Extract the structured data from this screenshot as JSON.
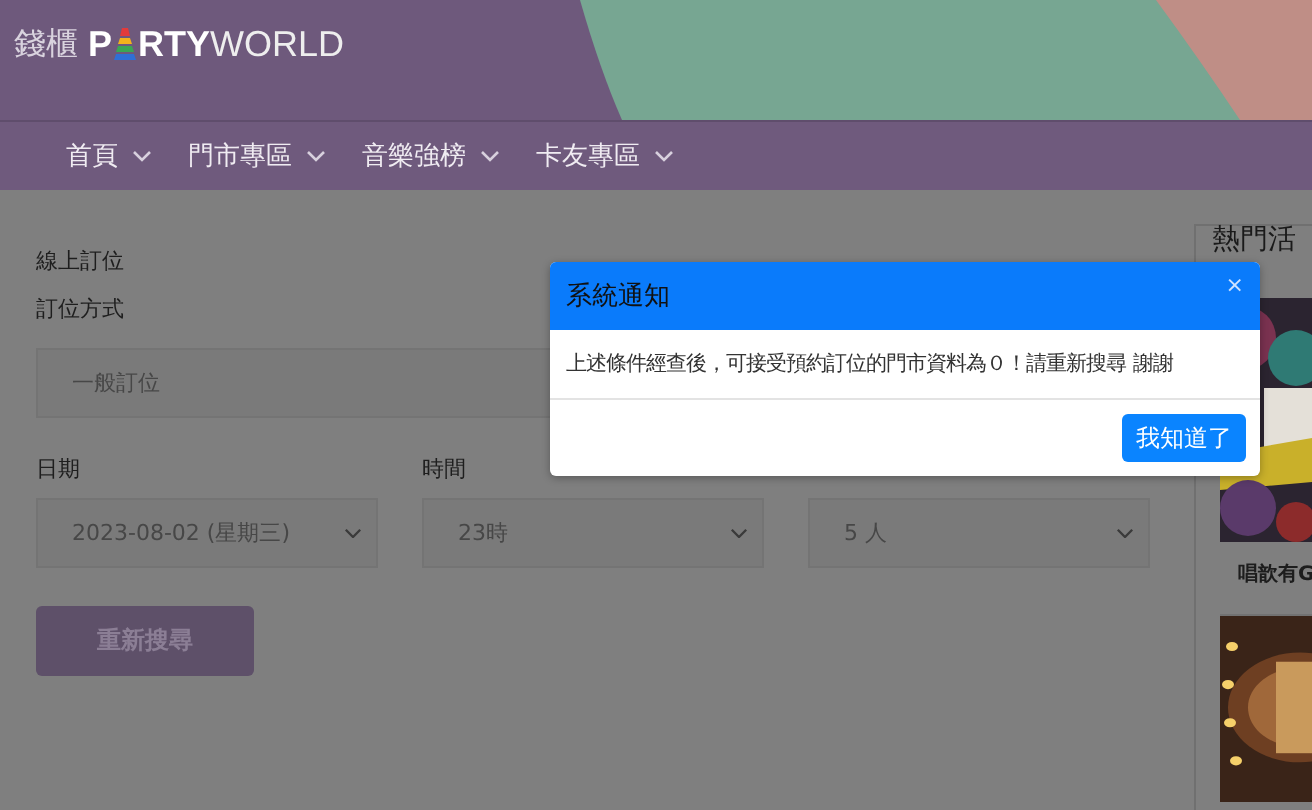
{
  "logo": {
    "brand": "錢櫃",
    "word_1": "P",
    "word_2": "RTY",
    "word_3": "WORLD"
  },
  "nav": [
    {
      "label": "首頁"
    },
    {
      "label": "門市專區"
    },
    {
      "label": "音樂強榜"
    },
    {
      "label": "卡友專區"
    }
  ],
  "form": {
    "heading": "線上訂位",
    "mode_label": "訂位方式",
    "mode_value": "一般訂位",
    "fields": [
      {
        "label": "日期",
        "value": "2023-08-02 (星期三)"
      },
      {
        "label": "時間",
        "value": "23時"
      },
      {
        "value": "5 人"
      }
    ],
    "search_button": "重新搜尋"
  },
  "sidebar": {
    "title": "熱門活",
    "cards": [
      {
        "kind": "picture",
        "caption": "唱歆有G"
      },
      {
        "kind": "picture"
      }
    ]
  },
  "dialog": {
    "title": "系統通知",
    "close": "×",
    "message": "上述條件經查後，可接受預約訂位的門市資料為０！請重新搜尋 謝謝",
    "button": "我知道了"
  }
}
